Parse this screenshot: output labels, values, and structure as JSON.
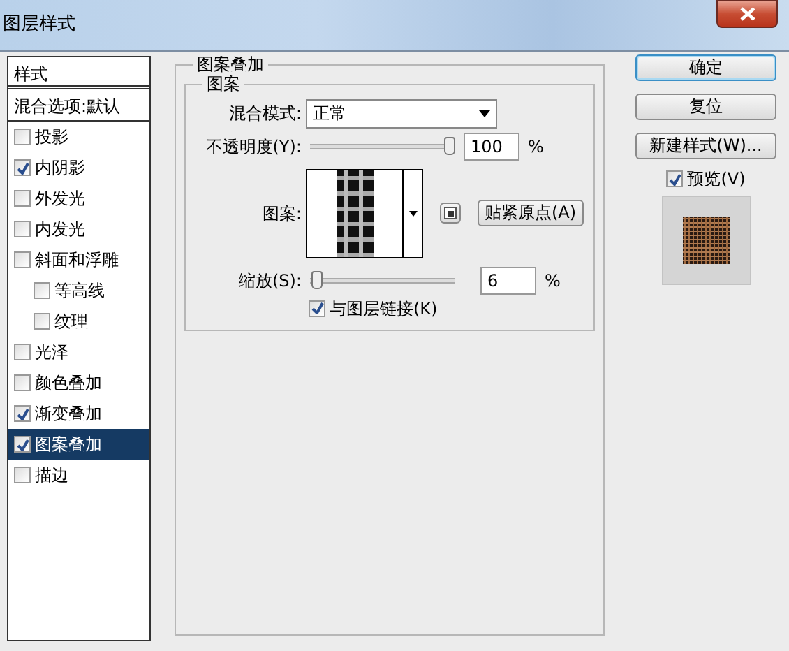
{
  "window": {
    "title": "图层样式"
  },
  "styles_panel": {
    "header": "样式",
    "blend_options": "混合选项:默认",
    "items": [
      {
        "label": "投影",
        "checked": false,
        "selected": false
      },
      {
        "label": "内阴影",
        "checked": true,
        "selected": false
      },
      {
        "label": "外发光",
        "checked": false,
        "selected": false
      },
      {
        "label": "内发光",
        "checked": false,
        "selected": false
      },
      {
        "label": "斜面和浮雕",
        "checked": false,
        "selected": false,
        "children": [
          {
            "label": "等高线",
            "checked": false,
            "selected": false
          },
          {
            "label": "纹理",
            "checked": false,
            "selected": false
          }
        ]
      },
      {
        "label": "光泽",
        "checked": false,
        "selected": false
      },
      {
        "label": "颜色叠加",
        "checked": false,
        "selected": false
      },
      {
        "label": "渐变叠加",
        "checked": true,
        "selected": false
      },
      {
        "label": "图案叠加",
        "checked": true,
        "selected": true
      },
      {
        "label": "描边",
        "checked": false,
        "selected": false
      }
    ]
  },
  "pattern_overlay": {
    "title": "图案叠加",
    "group_title": "图案",
    "blend_mode": {
      "label": "混合模式:",
      "value": "正常"
    },
    "opacity": {
      "label": "不透明度(Y):",
      "level": 1,
      "value": "100",
      "unit": "%"
    },
    "pattern": {
      "label": "图案:"
    },
    "snap_button": "贴紧原点(A)",
    "scale": {
      "label": "缩放(S):",
      "level": 0.01,
      "value": "6",
      "unit": "%"
    },
    "link": {
      "label": "与图层链接(K)",
      "checked": true
    }
  },
  "buttons": [
    {
      "label": "确定",
      "default": true
    },
    {
      "label": "复位",
      "default": false
    },
    {
      "label": "新建样式(W)...",
      "default": false
    }
  ],
  "preview": {
    "label": "预览(V)",
    "checked": true
  }
}
